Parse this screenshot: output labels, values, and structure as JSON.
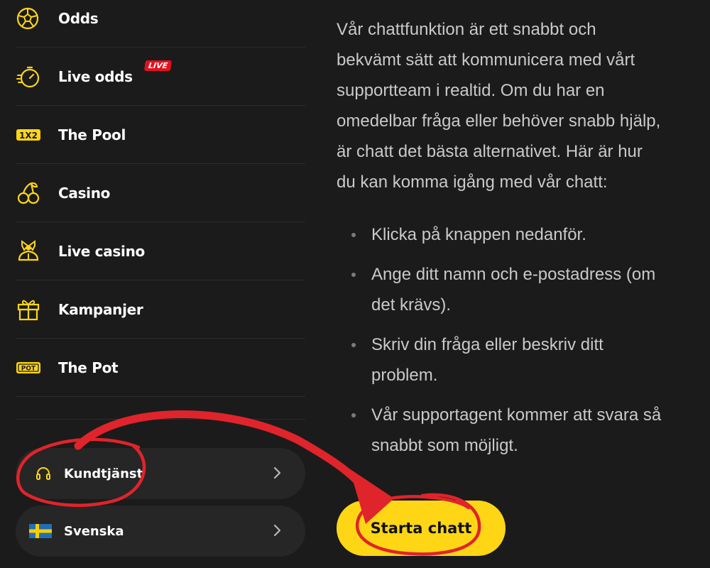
{
  "sidebar": {
    "items": [
      {
        "label": "Odds",
        "icon": "football-icon"
      },
      {
        "label": "Live odds",
        "icon": "stopwatch-icon",
        "badge": "LIVE"
      },
      {
        "label": "The Pool",
        "icon": "1x2-icon"
      },
      {
        "label": "Casino",
        "icon": "cherries-icon"
      },
      {
        "label": "Live casino",
        "icon": "dealer-icon"
      },
      {
        "label": "Kampanjer",
        "icon": "gift-icon"
      },
      {
        "label": "The Pot",
        "icon": "pot-icon"
      }
    ],
    "support": {
      "label": "Kundtjänst",
      "icon": "headset-icon"
    },
    "language": {
      "label": "Svenska",
      "icon": "swedish-flag-icon"
    }
  },
  "content": {
    "intro_lines": [
      "Vår chattfunktion är ett snabbt och",
      "bekvämt sätt att kommunicera med vårt",
      "supportteam i realtid. Om du har en",
      "omedelbar fråga eller behöver snabb hjälp,",
      "är chatt det bästa alternativet. Här är hur",
      "du kan komma igång med vår chatt:"
    ],
    "steps": [
      [
        "Klicka på knappen nedanför."
      ],
      [
        "Ange ditt namn och e-postadress (om",
        "det krävs)."
      ],
      [
        "Skriv din fråga eller beskriv ditt",
        "problem."
      ],
      [
        "Vår supportagent kommer att svara så",
        "snabbt som möjligt."
      ]
    ],
    "cta_label": "Starta chatt"
  },
  "colors": {
    "background": "#1b1b1b",
    "accent": "#ffd616",
    "live_badge": "#e3111e",
    "annotation": "#e0242b"
  }
}
